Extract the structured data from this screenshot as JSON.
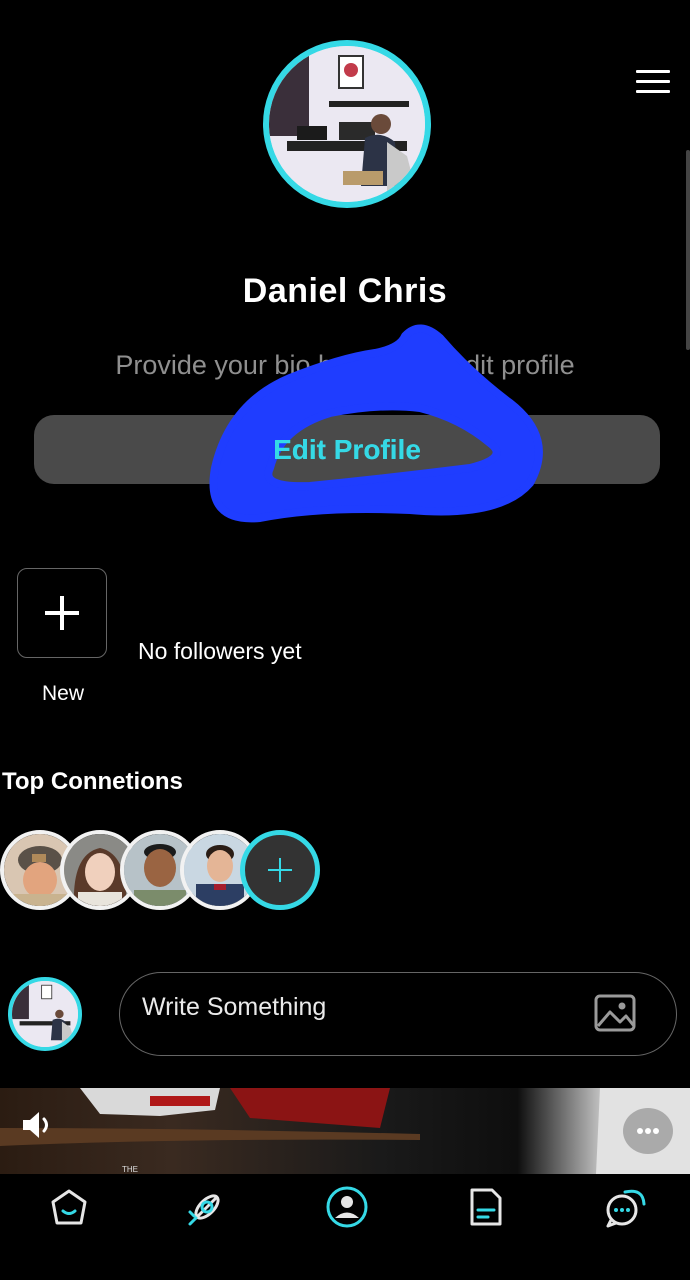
{
  "profile": {
    "name": "Daniel  Chris",
    "bio_placeholder": "Provide your bio by tapping edit profile",
    "edit_button_label": "Edit Profile"
  },
  "followers": {
    "new_label": "New",
    "empty_text": "No followers yet"
  },
  "connections": {
    "title": "Top Connetions",
    "avatars": [
      "connection-1",
      "connection-2",
      "connection-3",
      "connection-4"
    ]
  },
  "composer": {
    "placeholder": "Write Something"
  },
  "video": {
    "caption": "THE"
  },
  "nav": {
    "items": [
      "home-icon",
      "explore-icon",
      "profile-icon",
      "notes-icon",
      "chat-icon"
    ],
    "active": "profile-icon"
  },
  "colors": {
    "accent": "#35d9e6",
    "background": "#000000",
    "button_bg": "#4a4a4a",
    "muted_text": "#8f8f8f",
    "scribble": "#1f3dff"
  }
}
